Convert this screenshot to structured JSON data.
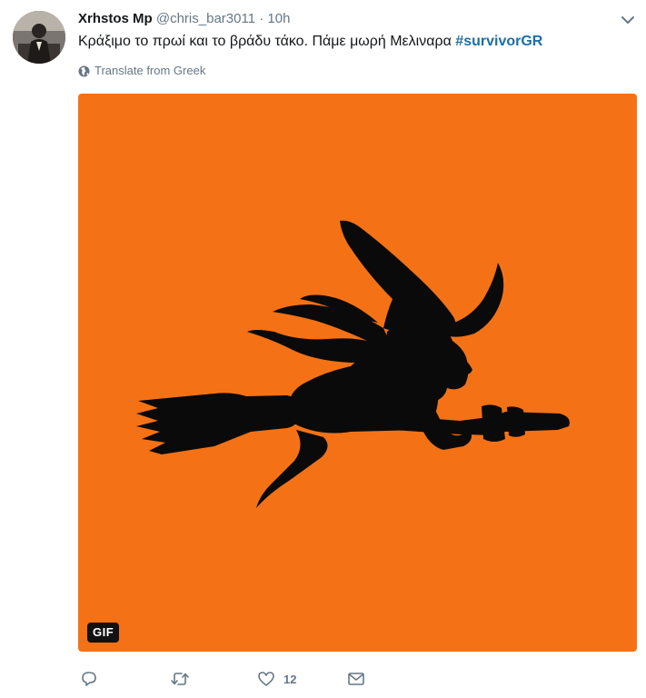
{
  "tweet": {
    "display_name": "Xrhstos Mp",
    "handle": "@chris_bar3011",
    "separator": "·",
    "time": "10h",
    "text": "Κράξιμο το πρωί και το βράδυ τάκο. Πάμε μωρή Μελιναρα",
    "hashtag": "#survivorGR",
    "translate_label": "Translate from Greek",
    "media_badge": "GIF",
    "media_background": "#f47215"
  },
  "actions": {
    "reply_icon": "reply-icon",
    "retweet_icon": "retweet-icon",
    "like_icon": "heart-icon",
    "like_count": "12",
    "message_icon": "envelope-icon"
  }
}
